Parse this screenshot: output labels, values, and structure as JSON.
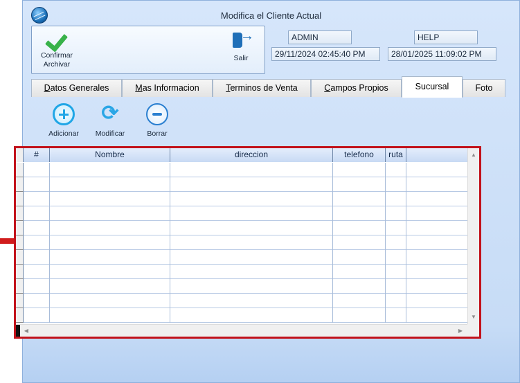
{
  "window": {
    "title": "Modifica el Cliente Actual"
  },
  "toolbar": {
    "confirm_line1": "Confirmar",
    "confirm_line2": "Archivar",
    "exit_label": "Salir"
  },
  "info": {
    "user": "ADMIN",
    "help": "HELP",
    "created": "29/11/2024 02:45:40 PM",
    "modified": "28/01/2025 11:09:02 PM"
  },
  "tabs": [
    {
      "label": "Datos Generales",
      "accel": "D",
      "rest": "atos Generales",
      "active": false
    },
    {
      "label": "Mas Informacion",
      "accel": "M",
      "rest": "as Informacion",
      "active": false
    },
    {
      "label": "Terminos de Venta",
      "accel": "T",
      "rest": "erminos de Venta",
      "active": false
    },
    {
      "label": "Campos Propios",
      "accel": "C",
      "rest": "ampos Propios",
      "active": false
    },
    {
      "label": "Sucursal",
      "active": true
    },
    {
      "label": "Foto",
      "active": false
    }
  ],
  "actions": {
    "add_label": "Adicionar",
    "edit_label": "Modificar",
    "delete_label": "Borrar"
  },
  "grid": {
    "columns": [
      "#",
      "Nombre",
      "direccion",
      "telefono",
      "ruta"
    ],
    "rows": [
      [],
      [],
      [],
      [],
      [],
      [],
      [],
      [],
      [],
      [],
      [],
      []
    ]
  },
  "icons": [
    "app-globe-icon",
    "checkmark-icon",
    "exit-door-icon",
    "plus-circle-icon",
    "refresh-icon",
    "minus-circle-icon",
    "red-arrow-icon"
  ],
  "colors": {
    "highlight_border": "#c2121b",
    "arrow": "#d11c1c",
    "accent_blue": "#20a6e6",
    "confirm_green": "#38b24a"
  }
}
